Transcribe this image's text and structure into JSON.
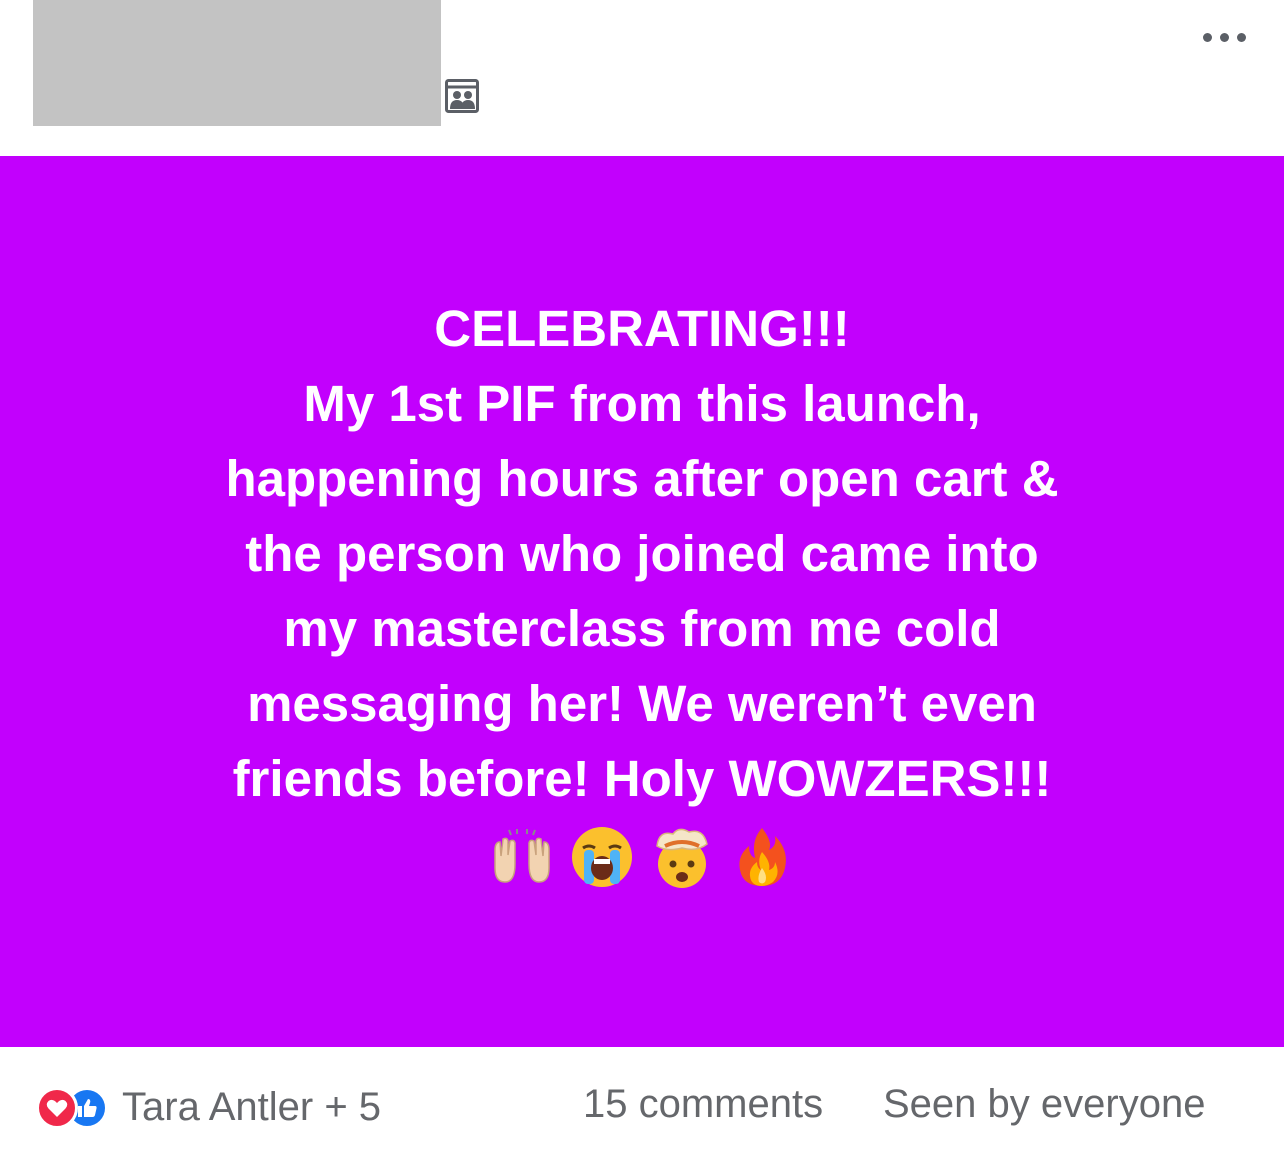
{
  "post": {
    "text_lines": [
      "CELEBRATING!!!",
      "My 1st PIF from this launch,",
      "happening hours after open cart &",
      "the person who joined came into",
      "my masterclass from me cold",
      "messaging her! We weren’t even",
      "friends before! Holy WOWZERS!!!"
    ],
    "emojis": [
      "raising-hands-emoji",
      "loudly-crying-face-emoji",
      "exploding-head-emoji",
      "fire-emoji"
    ],
    "background_color": "#c200fd"
  },
  "header": {
    "group_icon": "group-members-icon",
    "more_icon": "more-options-icon"
  },
  "footer": {
    "reaction_icons": [
      "love-reaction-icon",
      "like-reaction-icon"
    ],
    "reactors": "Tara Antler + 5",
    "comments": "15 comments",
    "seen_by": "Seen by everyone"
  },
  "colors": {
    "love": "#f0284a",
    "like": "#1877f2",
    "meta_text": "#65676b",
    "redacted": "#c3c3c3"
  }
}
